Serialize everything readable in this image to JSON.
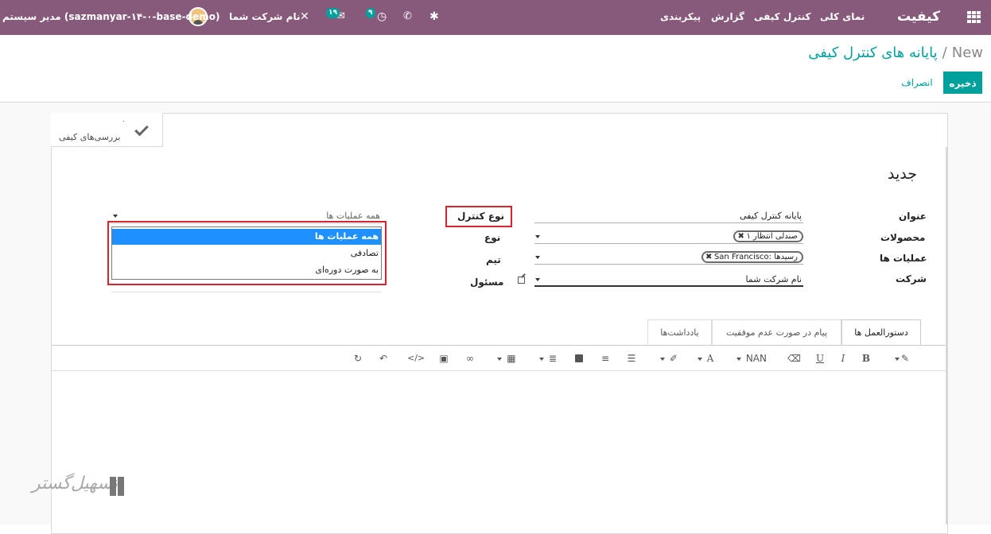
{
  "navbar": {
    "app_name": "کیفیت",
    "menu": [
      "نمای کلی",
      "کنترل کیفی",
      "گزارش",
      "پیکربندی"
    ],
    "activity_count": "۹",
    "message_count": "۱۹",
    "company": "نام شرکت شما",
    "user": "مدیر سیستم (sazmanyar-۱۴-۰-base-demo)"
  },
  "breadcrumb": {
    "parent": "پایانه های کنترل کیفی",
    "separator": "/",
    "current": "New"
  },
  "buttons": {
    "save": "ذخیره",
    "discard": "انصراف"
  },
  "stat_button": {
    "count": "۰",
    "label": "بررسی‌های کیفی"
  },
  "form": {
    "title": "جدید",
    "labels": {
      "name": "عنوان",
      "products": "محصولات",
      "operations": "عملیات ها",
      "company": "شرکت",
      "control_type": "نوع کنترل",
      "type": "نوع",
      "team": "تیم",
      "responsible": "مسئول"
    },
    "values": {
      "name": "پایانه کنترل کیفی",
      "company": "نام شرکت شما",
      "control_type": "همه عملیات ها"
    },
    "product_tags": [
      "صندلی انتظار ۱"
    ],
    "operation_tags": [
      "San Francisco: رسیدها"
    ],
    "control_type_options": [
      "همه عملیات ها",
      "تصادفی",
      "به صورت دوره‌ای"
    ]
  },
  "tabs": [
    "دستورالعمل ها",
    "پیام در صورت عدم موفقیت",
    "یادداشت‌ها"
  ],
  "toolbar": {
    "font_size": "NAN",
    "font_color": "A",
    "underline": "U",
    "italic": "I",
    "bold": "B"
  },
  "watermark": "تسهیل‌گستر"
}
